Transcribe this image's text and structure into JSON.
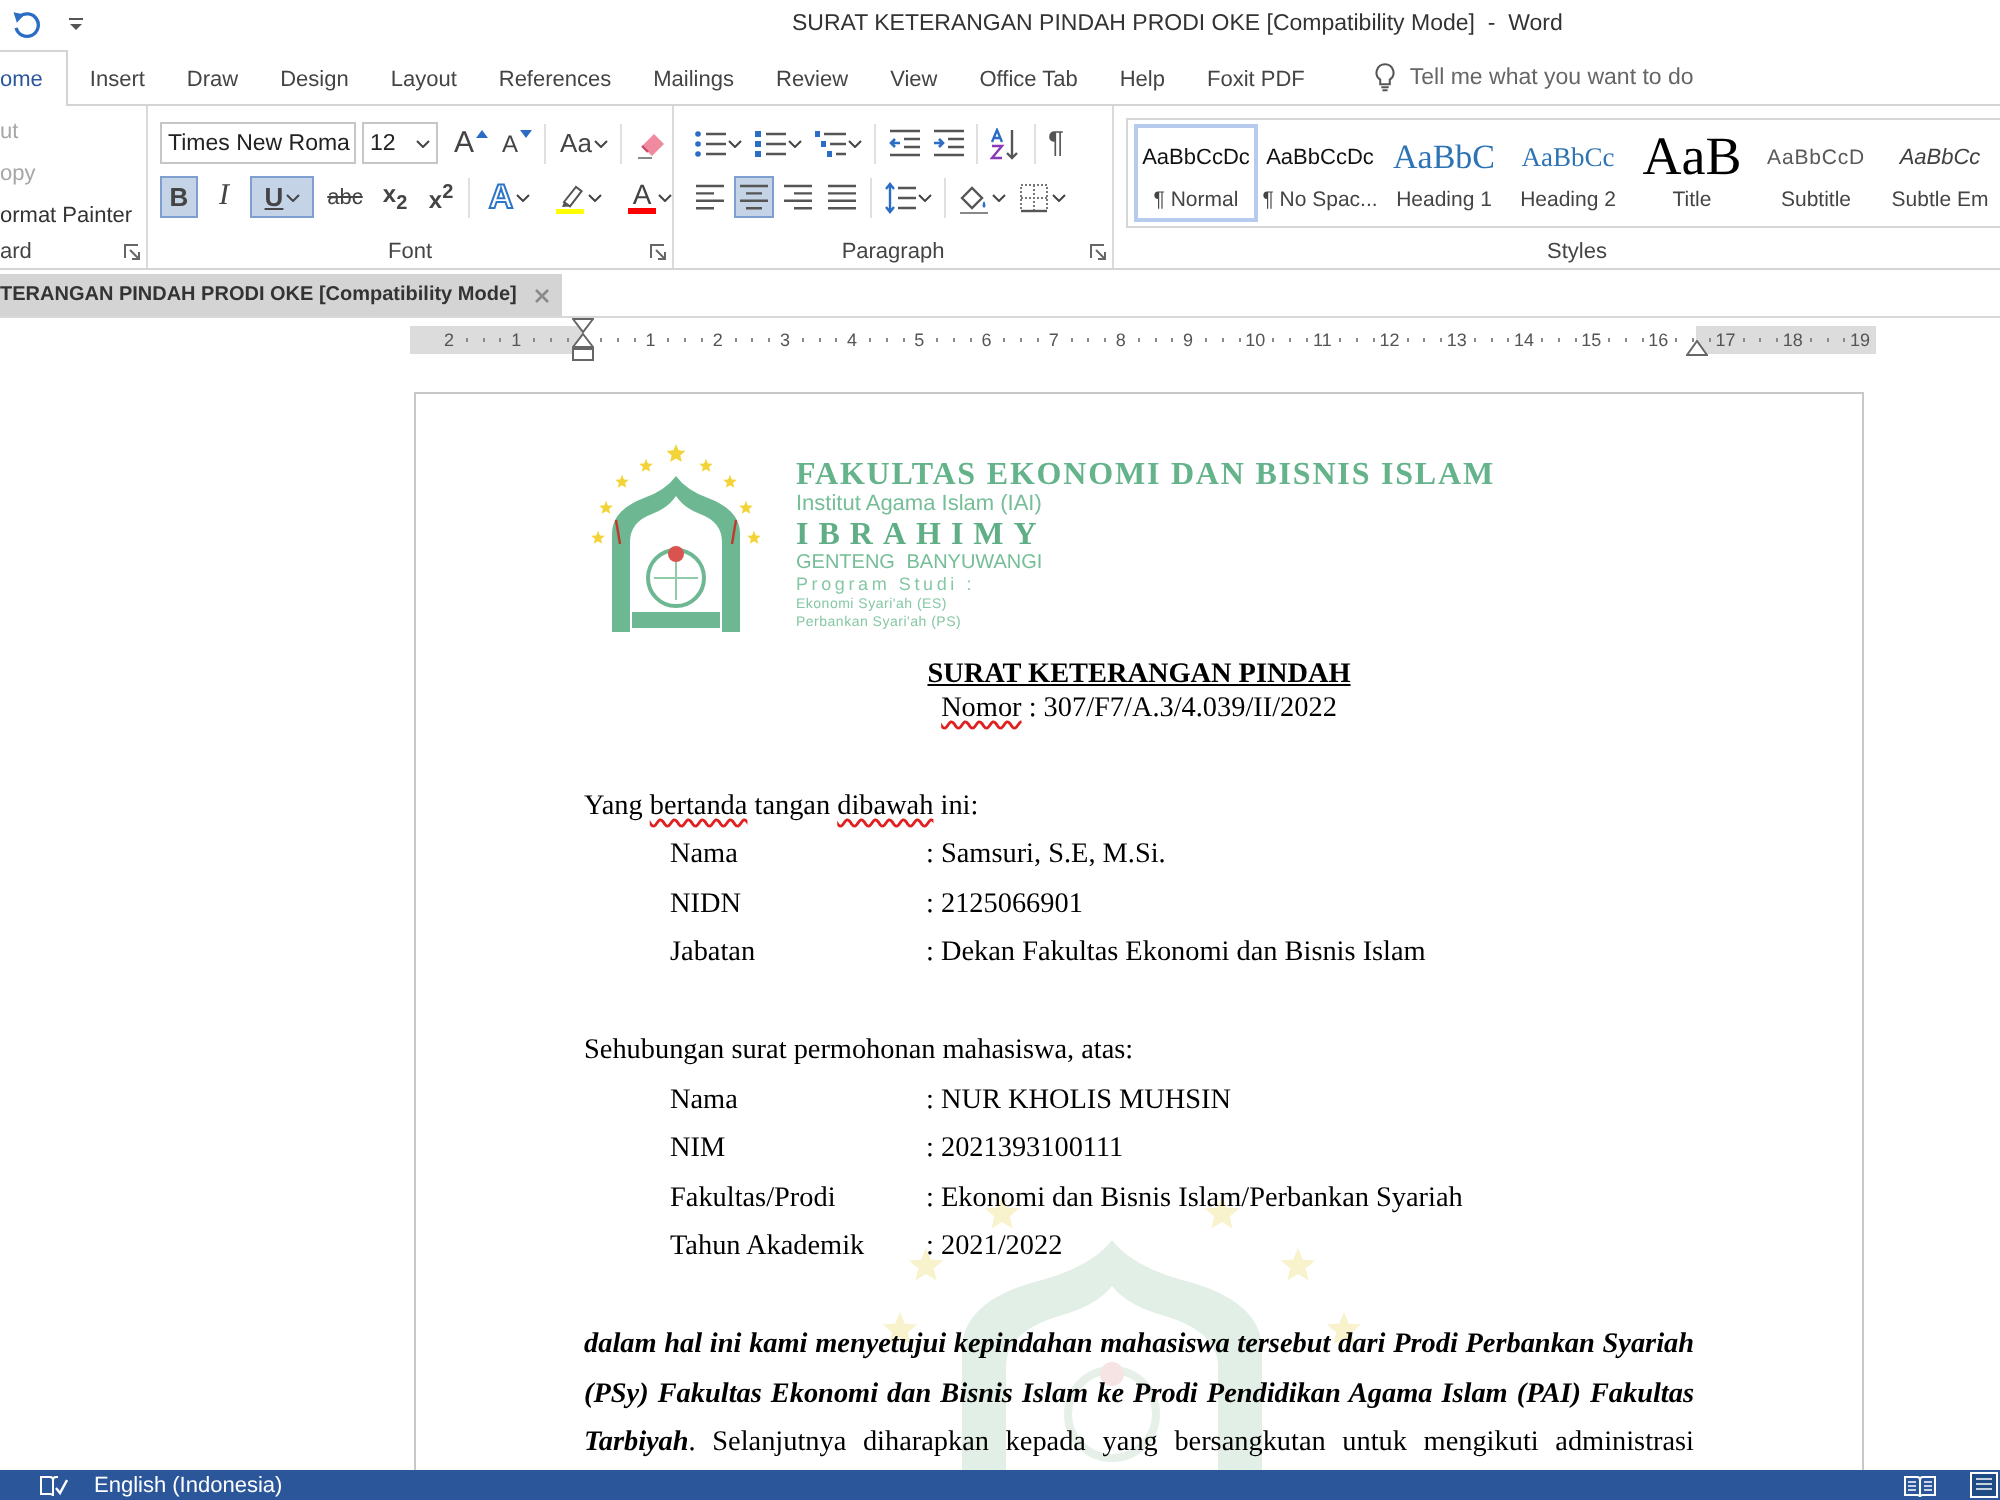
{
  "window": {
    "title": "SURAT KETERANGAN PINDAH PRODI OKE [Compatibility Mode]  -  Word"
  },
  "ribbon_tabs": [
    {
      "label": "ome",
      "selected": true
    },
    {
      "label": "Insert",
      "selected": false
    },
    {
      "label": "Draw",
      "selected": false
    },
    {
      "label": "Design",
      "selected": false
    },
    {
      "label": "Layout",
      "selected": false
    },
    {
      "label": "References",
      "selected": false
    },
    {
      "label": "Mailings",
      "selected": false
    },
    {
      "label": "Review",
      "selected": false
    },
    {
      "label": "View",
      "selected": false
    },
    {
      "label": "Office Tab",
      "selected": false
    },
    {
      "label": "Help",
      "selected": false
    },
    {
      "label": "Foxit PDF",
      "selected": false
    }
  ],
  "tell_me": {
    "placeholder": "Tell me what you want to do"
  },
  "clipboard": {
    "items": [
      {
        "label": "ut",
        "disabled": true
      },
      {
        "label": "opy",
        "disabled": true
      },
      {
        "label": "ormat Painter",
        "disabled": false
      }
    ],
    "group_label": "ard"
  },
  "font": {
    "font_name": "Times New Roma",
    "font_size": "12",
    "tools": [
      {
        "kind": "grow",
        "label": "A"
      },
      {
        "kind": "shrink",
        "label": "A"
      },
      {
        "kind": "case",
        "label": "Aa"
      },
      {
        "kind": "clear"
      }
    ],
    "formatting": [
      {
        "kind": "bold",
        "label": "B",
        "selected": true
      },
      {
        "kind": "italic",
        "label": "I",
        "selected": false
      },
      {
        "kind": "underline",
        "label": "U",
        "selected": true
      },
      {
        "kind": "strike",
        "label": "abc",
        "selected": false
      },
      {
        "kind": "subscript",
        "label": "x$_{2}$",
        "selected": false
      },
      {
        "kind": "superscript",
        "label": "x$^{2}$",
        "selected": false
      },
      {
        "kind": "effects",
        "label": "A",
        "selected": false
      },
      {
        "kind": "highlight",
        "color": "#ffff00",
        "selected": false
      },
      {
        "kind": "font_color",
        "label": "A",
        "color": "#ff0000",
        "selected": false
      }
    ],
    "group_label": "Font"
  },
  "paragraph": {
    "tools": [
      {
        "kind": "bullets",
        "selected": false
      },
      {
        "kind": "numbering",
        "selected": false
      },
      {
        "kind": "multilevel",
        "selected": false
      },
      {
        "kind": "outdent",
        "selected": false
      },
      {
        "kind": "indent",
        "selected": false
      },
      {
        "kind": "sort",
        "selected": false
      },
      {
        "kind": "marks",
        "label": "¶",
        "selected": false
      }
    ],
    "alignment": [
      {
        "kind": "left",
        "selected": false
      },
      {
        "kind": "center",
        "selected": true
      },
      {
        "kind": "right",
        "selected": false
      },
      {
        "kind": "justify",
        "selected": false
      },
      {
        "kind": "spacing",
        "selected": false
      },
      {
        "kind": "shading",
        "selected": false
      },
      {
        "kind": "borders",
        "selected": false
      }
    ],
    "group_label": "Paragraph"
  },
  "styles": {
    "items": [
      {
        "kind": "normal",
        "preview": "AaBbCcDc",
        "label": "¶ Normal",
        "selected": true
      },
      {
        "kind": "no_spacing",
        "preview": "AaBbCcDc",
        "label": "¶ No Spac...",
        "selected": false
      },
      {
        "kind": "heading1",
        "preview": "AaBbC",
        "label": "Heading 1",
        "selected": false
      },
      {
        "kind": "heading2",
        "preview": "AaBbCc",
        "label": "Heading 2",
        "selected": false
      },
      {
        "kind": "title",
        "preview": "AaB",
        "label": "Title",
        "selected": false
      },
      {
        "kind": "subtitle",
        "preview": "AaBbCcD",
        "label": "Subtitle",
        "selected": false
      },
      {
        "kind": "emphasis",
        "preview": "AaBbCc",
        "label": "Subtle Em",
        "selected": false
      }
    ],
    "group_label": "Styles"
  },
  "document_tab": {
    "label": "TERANGAN PINDAH PRODI OKE [Compatibility Mode]"
  },
  "ruler": {
    "left_numbers": [
      "2",
      "1"
    ],
    "numbers": [
      "1",
      "2",
      "3",
      "4",
      "5",
      "6",
      "7",
      "8",
      "9",
      "10",
      "11",
      "12",
      "13",
      "14",
      "15",
      "16",
      "17",
      "18",
      "19"
    ]
  },
  "letterhead": {
    "faculty": "FAKULTAS EKONOMI DAN BISNIS ISLAM",
    "institute": "Institut Agama Islam (IAI)",
    "name": "IBRAHIMY",
    "location": "GENTENG BANYUWANGI",
    "program_heading": "Program Studi :",
    "programs": [
      "Ekonomi Syari'ah (ES)",
      "Perbankan Syari'ah (PS)"
    ]
  },
  "letter": {
    "title": "SURAT KETERANGAN PINDAH",
    "number": [
      {
        "text": "Nomor",
        "misspelled": true
      },
      {
        "text": " : 307/F7/A.3/4.039/II/2022",
        "misspelled": false
      }
    ],
    "intro": [
      {
        "text": "Yang ",
        "misspelled": false
      },
      {
        "text": "bertanda",
        "misspelled": true
      },
      {
        "text": " tangan ",
        "misspelled": false
      },
      {
        "text": "dibawah",
        "misspelled": true
      },
      {
        "text": " ini:",
        "misspelled": false
      }
    ],
    "signer": [
      {
        "label": "Nama",
        "value": ": Samsuri, S.E, M.Si."
      },
      {
        "label": "NIDN",
        "value": ": 2125066901"
      },
      {
        "label": "Jabatan",
        "value": ": Dekan Fakultas Ekonomi dan Bisnis Islam"
      }
    ],
    "request": [
      {
        "text": "Sehubungan surat permohonan mahasiswa, atas:",
        "misspelled": false
      }
    ],
    "student": [
      {
        "label": "Nama",
        "value": ": NUR KHOLIS MUHSIN"
      },
      {
        "label": "NIM",
        "value": ": 2021393100111"
      },
      {
        "label": "Fakultas/Prodi",
        "value": ": Ekonomi dan Bisnis Islam/Perbankan Syariah"
      },
      {
        "label": "Tahun Akademik",
        "value": ": 2021/2022"
      }
    ],
    "body": [
      {
        "text": "dalam hal ini kami menyetujui kepindahan mahasiswa tersebut dari Prodi Perbankan Syariah (PSy) Fakultas Ekonomi dan Bisnis Islam ke Prodi Pendidikan Agama Islam (PAI) Fakultas Tarbiyah",
        "emphasis": true
      },
      {
        "text": ". Selanjutnya diharapkan kepada yang bersangkutan untuk mengikuti administrasi",
        "emphasis": false
      }
    ]
  },
  "status_bar": {
    "language": "English (Indonesia)"
  }
}
